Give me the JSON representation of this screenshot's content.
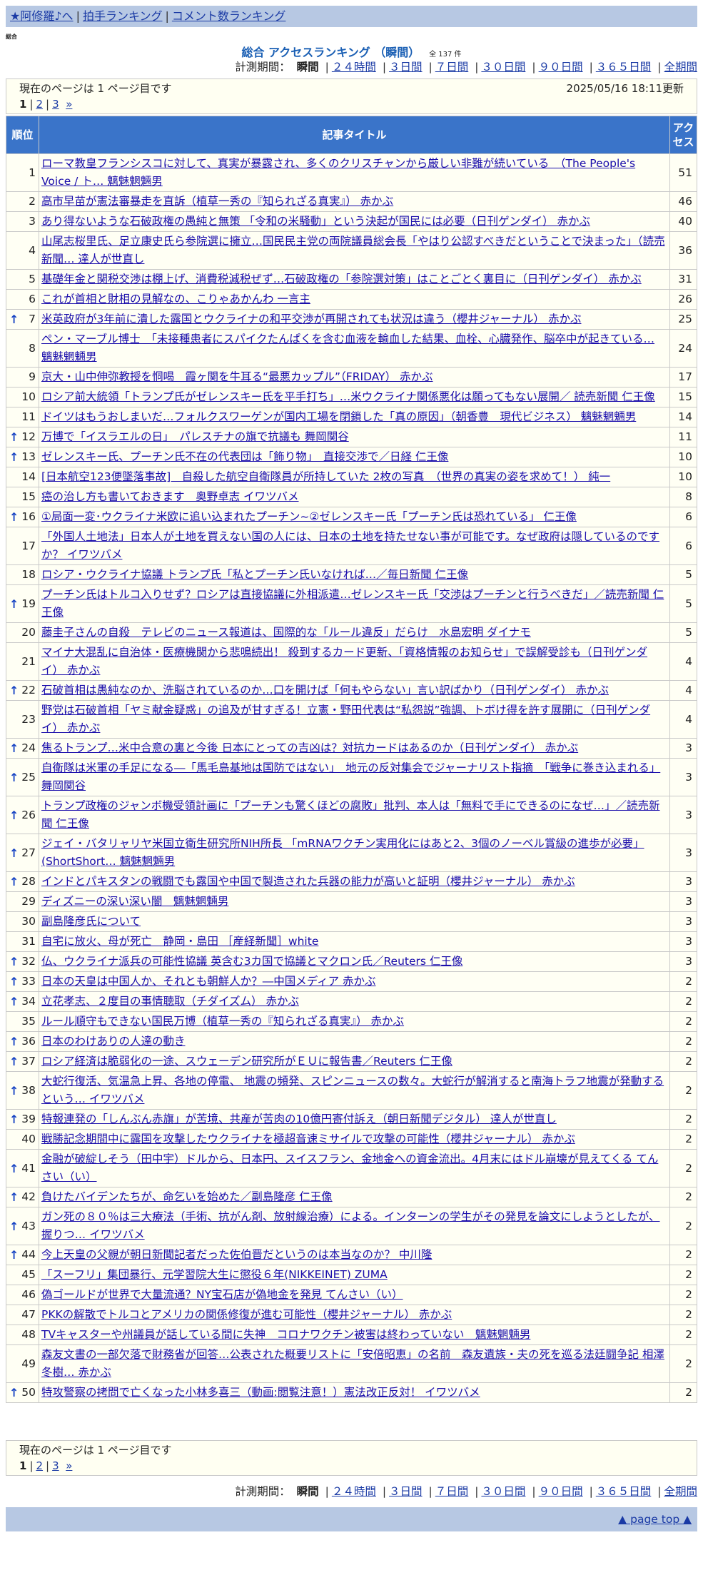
{
  "nav": {
    "home": "★阿修羅♪へ",
    "links": [
      "拍手ランキング",
      "コメント数ランキング"
    ]
  },
  "category_label": "総合",
  "ranking_title": "総合 アクセスランキング （瞬間）",
  "total_count": "全 137 件",
  "period": {
    "label": "計測期間：",
    "current": "瞬間",
    "options": [
      "２４時間",
      "３日間",
      "７日間",
      "３０日間",
      "９０日間",
      "３６５日間",
      "全期間"
    ]
  },
  "page_info": {
    "current_text": "現在のページは 1 ページ目です",
    "current_page": "1",
    "pages": [
      "2",
      "3"
    ],
    "next": "»",
    "updated": "2025/05/16 18:11更新"
  },
  "table_headers": {
    "rank": "順位",
    "title": "記事タイトル",
    "access": "アクセス"
  },
  "rows": [
    {
      "rank": "1",
      "up": false,
      "title": "ローマ教皇フランシスコに対して、真実が暴露され、多くのクリスチャンから厳しい非難が続いている　（The People's Voice / ト… 魑魅魍魎男",
      "count": "51"
    },
    {
      "rank": "2",
      "up": false,
      "title": "高市早苗が憲法審暴走を直訴（植草一秀の『知られざる真実』） 赤かぶ",
      "count": "46"
    },
    {
      "rank": "3",
      "up": false,
      "title": "あり得ないような石破政権の愚純と無策 「令和の米騒動」という決起が国民には必要（日刊ゲンダイ） 赤かぶ",
      "count": "40"
    },
    {
      "rank": "4",
      "up": false,
      "title": "山尾志桜里氏、足立康史氏ら参院選に擁立…国民民主党の両院議員総会長「やはり公認すべきだということで決まった」（読売新聞… 達人が世直し",
      "count": "36"
    },
    {
      "rank": "5",
      "up": false,
      "title": "基礎年金と関税交渉は棚上げ、消費税減税ぜず…石破政権の「参院選対策」はことごとく裏目に（日刊ゲンダイ） 赤かぶ",
      "count": "31"
    },
    {
      "rank": "6",
      "up": false,
      "title": "これが首相と財相の見解なの、こりゃあかんわ 一言主",
      "count": "26"
    },
    {
      "rank": "7",
      "up": true,
      "title": "米英政府が3年前に潰した露国とウクライナの和平交渉が再開されても状況は違う（櫻井ジャーナル） 赤かぶ",
      "count": "25"
    },
    {
      "rank": "8",
      "up": false,
      "title": "ペン・マーブル博士　「未接種患者にスパイクたんぱくを含む血液を輸血した結果、血栓、心臓発作、脳卒中が起きている… 魑魅魍魎男",
      "count": "24"
    },
    {
      "rank": "9",
      "up": false,
      "title": "京大・山中伸弥教授を恫喝　霞ヶ関を牛耳る“最悪カップル”（FRIDAY） 赤かぶ",
      "count": "17"
    },
    {
      "rank": "10",
      "up": false,
      "title": "ロシア前大統領「トランプ氏がゼレンスキー氏を平手打ち」…米ウクライナ関係悪化は願ってもない展開／ 読売新聞 仁王像",
      "count": "15"
    },
    {
      "rank": "11",
      "up": false,
      "title": "ドイツはもうおしまいだ…フォルクスワーゲンが国内工場を閉鎖した「真の原因」（朝香豊　現代ビジネス） 魑魅魍魎男",
      "count": "14"
    },
    {
      "rank": "12",
      "up": true,
      "title": "万博で「イスラエルの日」　パレスチナの旗で抗議も 舞岡関谷",
      "count": "11"
    },
    {
      "rank": "13",
      "up": true,
      "title": "ゼレンスキー氏、プーチン氏不在の代表団は「飾り物」　直接交渉で／日経 仁王像",
      "count": "10"
    },
    {
      "rank": "14",
      "up": false,
      "title": "[日本航空123便墜落事故]　自殺した航空自衛隊員が所持していた 2枚の写真　（世界の真実の姿を求めて！） 純一",
      "count": "10"
    },
    {
      "rank": "15",
      "up": false,
      "title": "癌の治し方も書いておきます　奥野卓志 イワツバメ",
      "count": "8"
    },
    {
      "rank": "16",
      "up": true,
      "title": "①局面一変･ウクライナ米欧に追い込まれたプーチン~②ゼレンスキー氏「プーチン氏は恐れている」 仁王像",
      "count": "6"
    },
    {
      "rank": "17",
      "up": false,
      "title": "「外国人土地法」日本人が土地を買えない国の人には、日本の土地を持たせない事が可能です。なぜ政府は隠しているのですか？ イワツバメ",
      "count": "6"
    },
    {
      "rank": "18",
      "up": false,
      "title": "ロシア・ウクライナ協議 トランプ氏「私とプーチン氏いなければ…／毎日新聞 仁王像",
      "count": "5"
    },
    {
      "rank": "19",
      "up": true,
      "title": "プーチン氏はトルコ入りせず？ロシアは直接協議に外相派遣…ゼレンスキー氏「交渉はプーチンと行うべきだ」／読売新聞 仁王像",
      "count": "5"
    },
    {
      "rank": "20",
      "up": false,
      "title": "藤圭子さんの自殺　テレビのニュース報道は、国際的な「ルール違反」だらけ　水島宏明 ダイナモ",
      "count": "5"
    },
    {
      "rank": "21",
      "up": false,
      "title": "マイナ大混乱に自治体・医療機関から悲鳴続出！ 殺到するカード更新、「資格情報のお知らせ」で誤解受診も（日刊ゲンダイ） 赤かぶ",
      "count": "4"
    },
    {
      "rank": "22",
      "up": true,
      "title": "石破首相は愚純なのか、洗脳されているのか…口を開けば「何もやらない」言い訳ばかり（日刊ゲンダイ） 赤かぶ",
      "count": "4"
    },
    {
      "rank": "23",
      "up": false,
      "title": "野党は石破首相「ヤミ献金疑惑」の追及が甘すぎる！立憲・野田代表は“私怨説”強調、トボけ得を許す展開に（日刊ゲンダイ） 赤かぶ",
      "count": "4"
    },
    {
      "rank": "24",
      "up": true,
      "title": "焦るトランプ…米中合意の裏と今後 日本にとっての吉凶は？対抗カードはあるのか（日刊ゲンダイ） 赤かぶ",
      "count": "3"
    },
    {
      "rank": "25",
      "up": true,
      "title": "自衛隊は米軍の手足になる―「馬毛島基地は国防ではない」　地元の反対集会でジャーナリスト指摘　「戦争に巻き込まれる」 舞岡関谷",
      "count": "3"
    },
    {
      "rank": "26",
      "up": true,
      "title": "トランプ政権のジャンボ機受領計画に「プーチンも驚くほどの腐敗」批判、本人は「無料で手にできるのになぜ…」／読売新聞 仁王像",
      "count": "3"
    },
    {
      "rank": "27",
      "up": true,
      "title": "ジェイ・バタリャリヤ米国立衛生研究所NIH所長 「mRNAワクチン実用化にはあと2、3個のノーベル賞級の進歩が必要」(ShortShort… 魑魅魍魎男",
      "count": "3"
    },
    {
      "rank": "28",
      "up": true,
      "title": "インドとパキスタンの戦闘でも露国や中国で製造された兵器の能力が高いと証明（櫻井ジャーナル） 赤かぶ",
      "count": "3"
    },
    {
      "rank": "29",
      "up": false,
      "title": "ディズニーの深い深い闇　魑魅魍魎男",
      "count": "3"
    },
    {
      "rank": "30",
      "up": false,
      "title": "副島隆彦氏について",
      "count": "3"
    },
    {
      "rank": "31",
      "up": false,
      "title": "自宅に放火、母が死亡　静岡・島田 ［産経新聞］white",
      "count": "3"
    },
    {
      "rank": "32",
      "up": true,
      "title": "仏、ウクライナ派兵の可能性協議 英含む3カ国で協議とマクロン氏／Reuters 仁王像",
      "count": "3"
    },
    {
      "rank": "33",
      "up": true,
      "title": "日本の天皇は中国人か、それとも朝鮮人か？―中国メディア 赤かぶ",
      "count": "2"
    },
    {
      "rank": "34",
      "up": true,
      "title": "立花孝志、２度目の事情聴取（チダイズム） 赤かぶ",
      "count": "2"
    },
    {
      "rank": "35",
      "up": false,
      "title": "ルール順守もできない国民万博（植草一秀の『知られざる真実』） 赤かぶ",
      "count": "2"
    },
    {
      "rank": "36",
      "up": true,
      "title": "日本のわけありの人達の動き",
      "count": "2"
    },
    {
      "rank": "37",
      "up": true,
      "title": "ロシア経済は脆弱化の一途、スウェーデン研究所がＥＵに報告書／Reuters 仁王像",
      "count": "2"
    },
    {
      "rank": "38",
      "up": true,
      "title": "大蛇行復活、気温急上昇、各地の停電、 地震の頻発、スピンニュースの数々。大蛇行が解消すると南海トラフ地震が発動するという… イワツバメ",
      "count": "2"
    },
    {
      "rank": "39",
      "up": true,
      "title": "特報連発の「しんぶん赤旗」が苦境、共産が苦肉の10億円寄付訴え（朝日新聞デジタル） 達人が世直し",
      "count": "2"
    },
    {
      "rank": "40",
      "up": false,
      "title": "戦勝記念期間中に露国を攻撃したウクライナを極超音速ミサイルで攻撃の可能性（櫻井ジャーナル） 赤かぶ",
      "count": "2"
    },
    {
      "rank": "41",
      "up": true,
      "title": "金融が破綻しそう（田中宇）ドルから、日本円、スイスフラン、金地金への資金流出。4月末にはドル崩壊が見えてくる てんさい（い）",
      "count": "2"
    },
    {
      "rank": "42",
      "up": true,
      "title": "負けたバイデンたちが、命乞いを始めた／副島隆彦 仁王像",
      "count": "2"
    },
    {
      "rank": "43",
      "up": true,
      "title": "ガン死の８０％は三大療法（手術、抗がん剤、放射線治療）による。インターンの学生がその発見を論文にしようとしたが、握りつ… イワツバメ",
      "count": "2"
    },
    {
      "rank": "44",
      "up": true,
      "title": "今上天皇の父親が朝日新聞記者だった佐伯晋だというのは本当なのか？ 中川隆",
      "count": "2"
    },
    {
      "rank": "45",
      "up": false,
      "title": "「スーフリ」集団暴行、元学習院大生に懲役６年(NIKKEINET) ZUMA",
      "count": "2"
    },
    {
      "rank": "46",
      "up": false,
      "title": "偽ゴールドが世界で大量流通？NY宝石店が偽地金を発見 てんさい（い）",
      "count": "2"
    },
    {
      "rank": "47",
      "up": false,
      "title": "PKKの解散でトルコとアメリカの関係修復が進む可能性（櫻井ジャーナル） 赤かぶ",
      "count": "2"
    },
    {
      "rank": "48",
      "up": false,
      "title": "TVキャスターや州議員が話している間に失神　コロナワクチン被害は終わっていない　魑魅魍魎男",
      "count": "2"
    },
    {
      "rank": "49",
      "up": false,
      "title": "森友文書の一部欠落で財務省が回答…公表された概要リストに「安倍昭恵」の名前　森友遺族・夫の死を巡る法廷闘争記 相澤冬樹… 赤かぶ",
      "count": "2"
    },
    {
      "rank": "50",
      "up": true,
      "title": "特攻警察の拷問で亡くなった小林多喜三（動画:閲覧注意！）憲法改正反対！ イワツバメ",
      "count": "2"
    }
  ],
  "footer": {
    "page_top": "▲ page top ▲"
  }
}
